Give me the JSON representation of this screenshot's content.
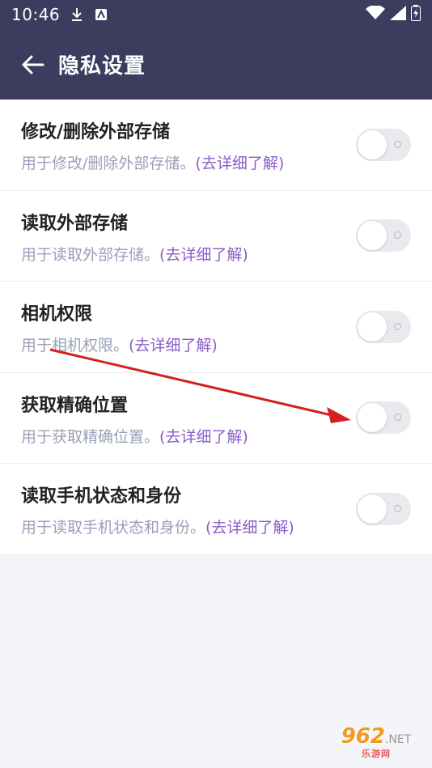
{
  "status_bar": {
    "time": "10:46",
    "icons": [
      "download-icon",
      "notification-icon",
      "wifi-icon",
      "signal-icon",
      "battery-icon"
    ]
  },
  "app_bar": {
    "title": "隐私设置",
    "back_icon": "arrow-left-icon"
  },
  "settings": [
    {
      "title": "修改/删除外部存储",
      "desc": "用于修改/删除外部存储。",
      "link": "(去详细了解)",
      "enabled": false
    },
    {
      "title": "读取外部存储",
      "desc": "用于读取外部存储。",
      "link": "(去详细了解)",
      "enabled": false
    },
    {
      "title": "相机权限",
      "desc": "用于相机权限。",
      "link": "(去详细了解)",
      "enabled": false
    },
    {
      "title": "获取精确位置",
      "desc": "用于获取精确位置。",
      "link": "(去详细了解)",
      "enabled": false
    },
    {
      "title": "读取手机状态和身份",
      "desc": "用于读取手机状态和身份。",
      "link": "(去详细了解)",
      "enabled": false
    }
  ],
  "colors": {
    "header_bg": "#3b3c5e",
    "link": "#8a5cc9",
    "desc": "#9aa0b8",
    "annotation_arrow": "#d42020"
  },
  "watermark": {
    "main": "962",
    "net": ".NET",
    "sub": "乐游网"
  }
}
